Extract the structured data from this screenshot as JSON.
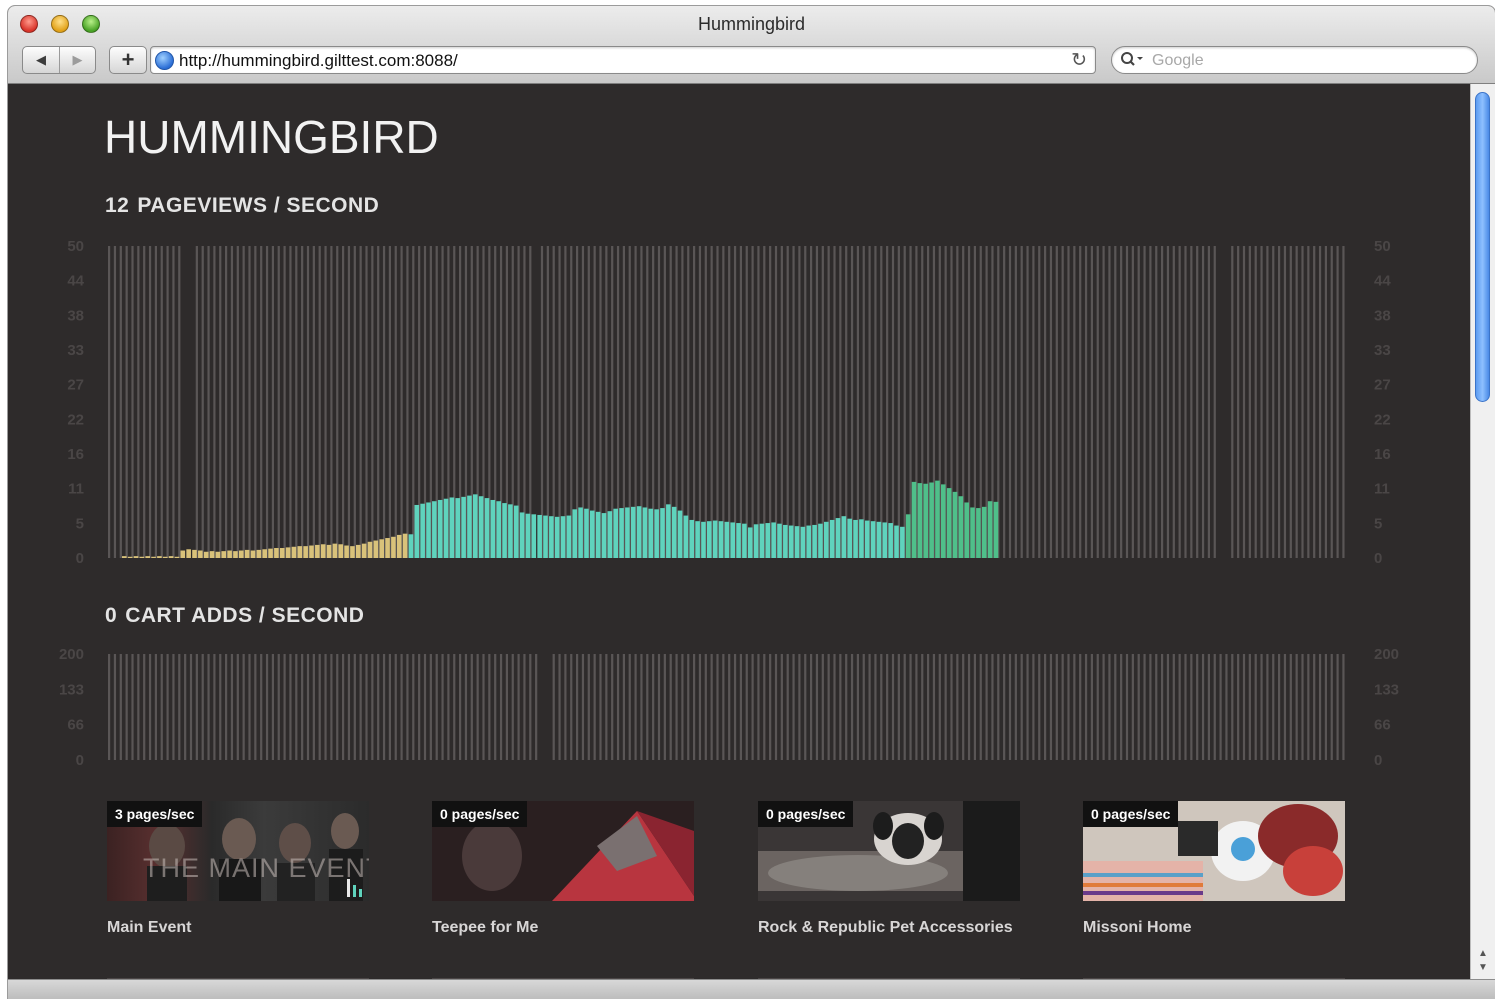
{
  "window": {
    "title": "Hummingbird"
  },
  "toolbar": {
    "back_icon": "back-arrow-icon",
    "forward_icon": "forward-arrow-icon",
    "add_icon": "plus-icon",
    "url": "http://hummingbird.gilttest.com:8088/",
    "reload_icon": "reload-icon",
    "search_placeholder": "Google"
  },
  "page": {
    "logo": "HUMMINGBIRD",
    "pageviews": {
      "value": "12",
      "label": "PAGEVIEWS / SECOND"
    },
    "cart_adds": {
      "value": "0",
      "label": "CART ADDS / SECOND"
    }
  },
  "cards": [
    {
      "badge": "3 pages/sec",
      "label": "Main Event",
      "overlay": "THE MAIN EVENT"
    },
    {
      "badge": "0 pages/sec",
      "label": "Teepee for Me"
    },
    {
      "badge": "0 pages/sec",
      "label": "Rock & Republic Pet Accessories"
    },
    {
      "badge": "0 pages/sec",
      "label": "Missoni Home"
    }
  ],
  "colors": {
    "yellow": "#d9c27a",
    "teal": "#5fd3bd",
    "green": "#4fbf8a",
    "grid": "#5a5656",
    "background": "#2e2b2b"
  },
  "chart_data": [
    {
      "type": "bar",
      "title": "12 PAGEVIEWS / SECOND",
      "ylim": [
        0,
        50
      ],
      "y_ticks": [
        "50",
        "44",
        "38",
        "33",
        "27",
        "22",
        "16",
        "11",
        "5",
        "0"
      ],
      "series": [
        {
          "color": "#d9c27a",
          "values": [
            0.3,
            0.2,
            0.3,
            0.2,
            0.3,
            0.2,
            0.3,
            0.2,
            0.3,
            0.2,
            1.2,
            1.4,
            1.3,
            1.2,
            1.0,
            1.1,
            1.0,
            1.1,
            1.2,
            1.1,
            1.2,
            1.3,
            1.2,
            1.3,
            1.4,
            1.5,
            1.6,
            1.6,
            1.7,
            1.8,
            1.9,
            1.9,
            2.0,
            2.1,
            2.2,
            2.1,
            2.3,
            2.2,
            2.0,
            1.9,
            2.1,
            2.3,
            2.6,
            2.8,
            3.0,
            3.2,
            3.4,
            3.7,
            3.9
          ]
        },
        {
          "color": "#5fd3bd",
          "values": [
            3.8,
            8.5,
            8.7,
            8.9,
            9.1,
            9.3,
            9.5,
            9.7,
            9.6,
            9.8,
            10.0,
            10.2,
            9.9,
            9.6,
            9.3,
            9.1,
            8.8,
            8.6,
            8.4,
            7.3,
            7.1,
            7.0,
            6.9,
            6.8,
            6.7,
            6.6,
            6.7,
            6.8,
            7.8,
            8.1,
            7.9,
            7.6,
            7.4,
            7.2,
            7.5,
            7.9,
            8.0,
            8.1,
            8.2,
            8.3,
            8.1,
            7.9,
            7.8,
            8.0,
            8.6,
            8.2,
            7.6,
            6.8,
            6.1,
            5.9,
            5.8,
            5.9,
            6.0,
            5.9,
            5.8,
            5.7,
            5.6,
            5.5,
            4.9,
            5.4,
            5.5,
            5.6,
            5.7,
            5.5,
            5.3,
            5.2,
            5.1,
            5.0,
            5.2,
            5.3,
            5.5,
            5.8,
            6.1,
            6.4,
            6.7,
            6.3,
            6.1,
            6.2,
            6.0,
            5.9,
            5.8,
            5.7,
            5.6,
            5.2,
            5.0
          ]
        },
        {
          "color": "#4fbf8a",
          "values": [
            7.0,
            12.2,
            12.0,
            11.9,
            12.1,
            12.4,
            11.8,
            11.2,
            10.6,
            9.9,
            8.9,
            8.1,
            8.0,
            8.2,
            9.1,
            9.0
          ]
        }
      ]
    },
    {
      "type": "bar",
      "title": "0 CART ADDS / SECOND",
      "ylim": [
        0,
        200
      ],
      "y_ticks": [
        "200",
        "133",
        "66",
        "0"
      ],
      "series": [
        {
          "color": "#5fd3bd",
          "values": []
        }
      ]
    }
  ]
}
